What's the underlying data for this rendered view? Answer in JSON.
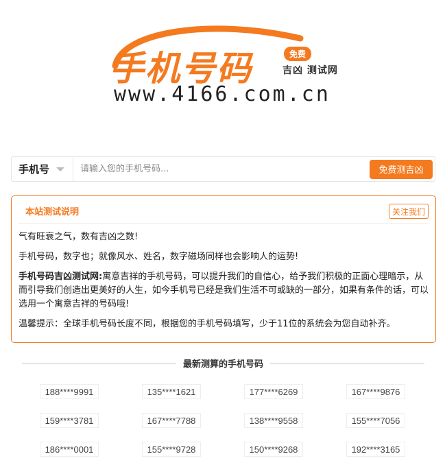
{
  "logo": {
    "title": "手机号码",
    "badge": "免费",
    "subtitle": "吉凶 测试网",
    "url": "www.4166.com.cn"
  },
  "search": {
    "type_label": "手机号",
    "placeholder": "请输入您的手机号码...",
    "button_label": "免费测吉凶"
  },
  "info": {
    "title": "本站测试说明",
    "follow_label": "关注我们",
    "p1": "气有旺衰之气，数有吉凶之数!",
    "p2": "手机号码，数字也；就像风水、姓名，数字磁场同样也会影响人的运势!",
    "p3_bold": "手机号码吉凶测试网:",
    "p3_text": "寓意吉祥的手机号码，可以提升我们的自信心，给予我们积极的正面心理暗示，从而引导我们创造出更美好的人生，如今手机号已经是我们生活不可或缺的一部分，如果有条件的话，可以选用一个寓意吉祥的号码哦!",
    "p4": "温馨提示：全球手机号码长度不同，根据您的手机号码填写，少于11位的系统会为您自动补齐。"
  },
  "recent": {
    "title": "最新测算的手机号码",
    "numbers": [
      "188****9991",
      "135****1621",
      "177****6269",
      "167****9876",
      "159****3781",
      "167****7788",
      "138****9558",
      "155****7056",
      "186****0001",
      "155****9728",
      "150****9268",
      "192****3165"
    ]
  },
  "colors": {
    "accent": "#f47a20",
    "text": "#333333",
    "border": "#e5e5e5"
  }
}
